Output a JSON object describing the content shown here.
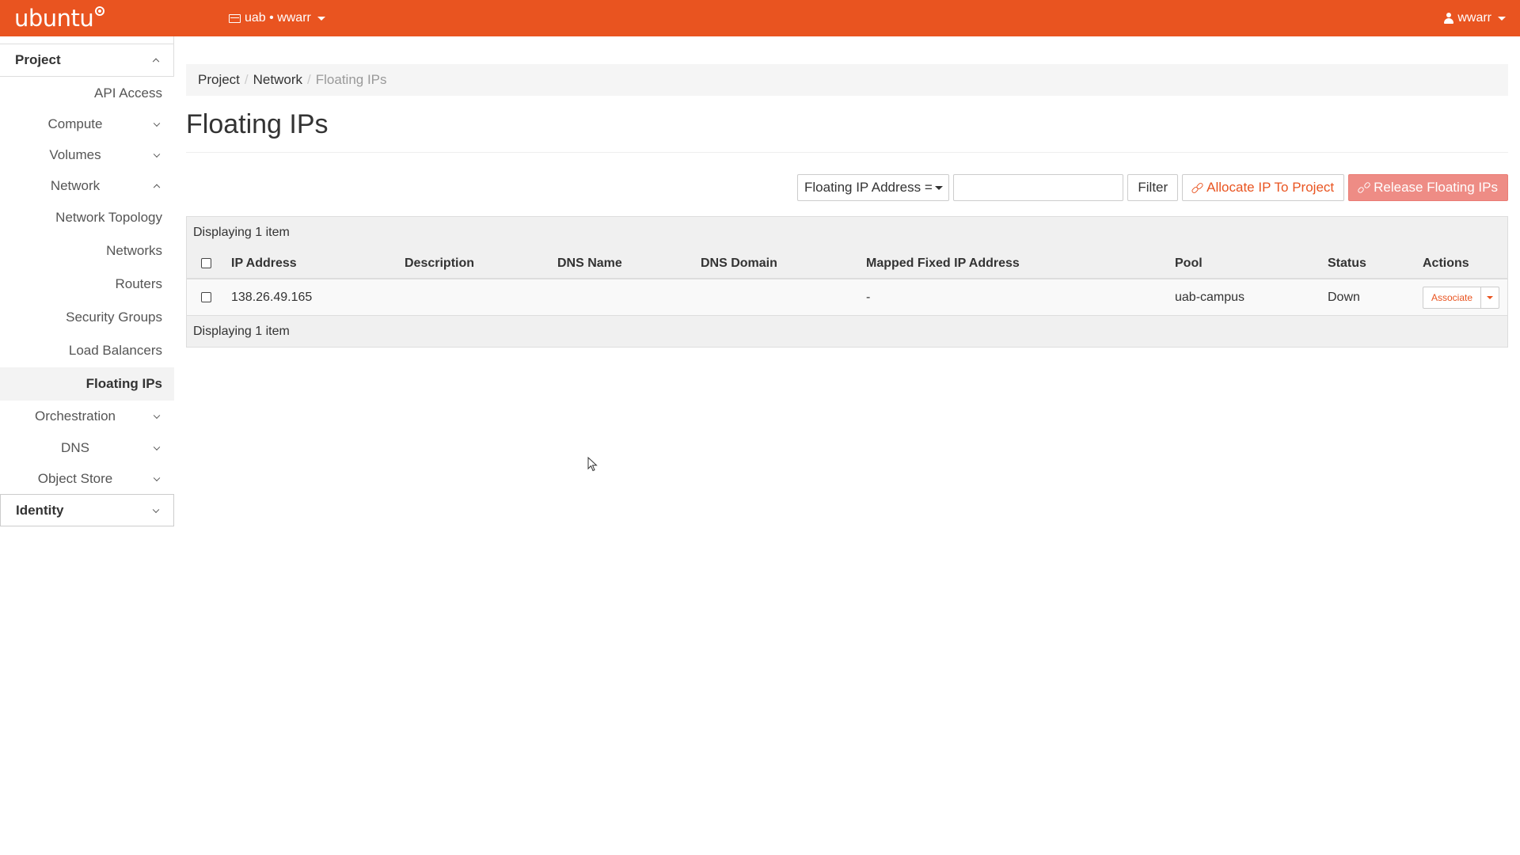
{
  "navbar": {
    "brand": "ubuntu",
    "project_switch": "uab • wwarr",
    "user": "wwarr",
    "bg_color": "#e95420"
  },
  "sidebar": {
    "project_label": "Project",
    "items": [
      {
        "label": "API Access"
      },
      {
        "label": "Compute",
        "chevron": "down"
      },
      {
        "label": "Volumes",
        "chevron": "down"
      },
      {
        "label": "Network",
        "chevron": "up"
      },
      {
        "label": "Network Topology"
      },
      {
        "label": "Networks"
      },
      {
        "label": "Routers"
      },
      {
        "label": "Security Groups"
      },
      {
        "label": "Load Balancers"
      },
      {
        "label": "Floating IPs",
        "active": true
      },
      {
        "label": "Orchestration",
        "chevron": "down"
      },
      {
        "label": "DNS",
        "chevron": "down"
      },
      {
        "label": "Object Store",
        "chevron": "down"
      }
    ],
    "identity_label": "Identity"
  },
  "breadcrumb": {
    "items": [
      "Project",
      "Network"
    ],
    "current": "Floating IPs"
  },
  "page": {
    "title": "Floating IPs"
  },
  "toolbar": {
    "filter_select": "Floating IP Address =",
    "filter_input_value": "",
    "filter_button": "Filter",
    "allocate_button": "Allocate IP To Project",
    "release_button": "Release Floating IPs"
  },
  "table": {
    "caption": "Displaying 1 item",
    "footer": "Displaying 1 item",
    "columns": [
      "IP Address",
      "Description",
      "DNS Name",
      "DNS Domain",
      "Mapped Fixed IP Address",
      "Pool",
      "Status",
      "Actions"
    ],
    "rows": [
      {
        "ip_address": "138.26.49.165",
        "description": "",
        "dns_name": "",
        "dns_domain": "",
        "mapped_fixed_ip": "-",
        "pool": "uab-campus",
        "status": "Down",
        "action": "Associate"
      }
    ]
  },
  "colors": {
    "accent": "#e95420",
    "danger_button": "#ee8c85"
  }
}
